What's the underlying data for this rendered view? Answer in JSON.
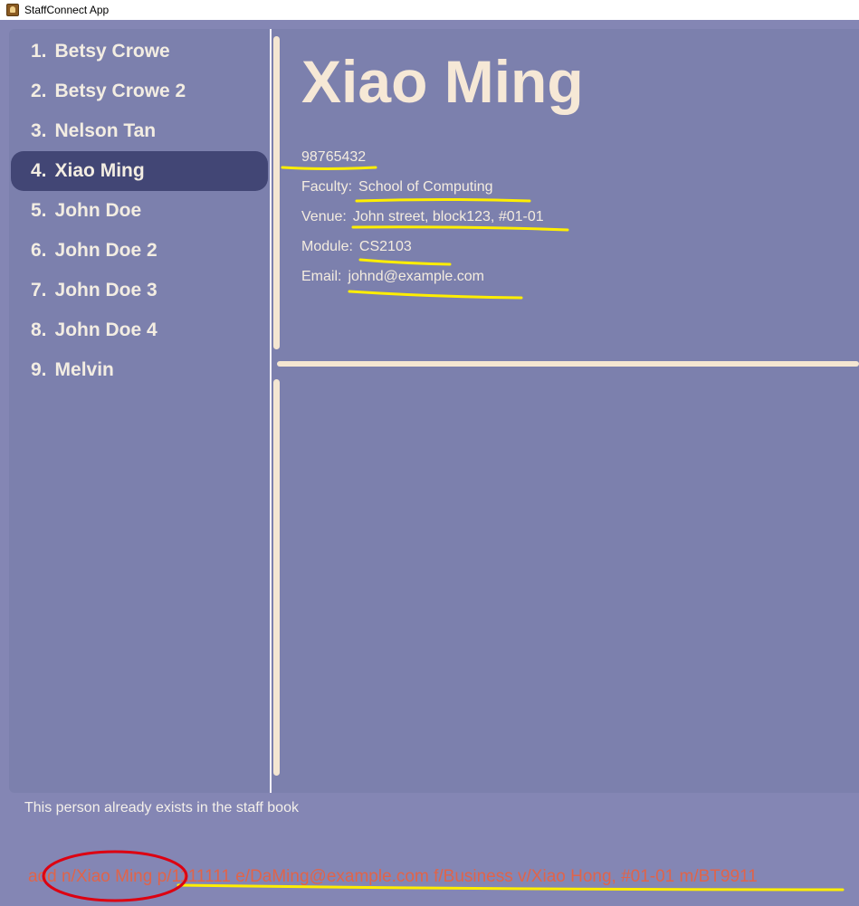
{
  "window": {
    "title": "StaffConnect App"
  },
  "person_list": [
    {
      "index": "1.",
      "name": "Betsy Crowe"
    },
    {
      "index": "2.",
      "name": "Betsy Crowe 2"
    },
    {
      "index": "3.",
      "name": "Nelson Tan"
    },
    {
      "index": "4.",
      "name": "Xiao Ming"
    },
    {
      "index": "5.",
      "name": "John Doe"
    },
    {
      "index": "6.",
      "name": "John Doe 2"
    },
    {
      "index": "7.",
      "name": "John Doe 3"
    },
    {
      "index": "8.",
      "name": "John Doe 4"
    },
    {
      "index": "9.",
      "name": "Melvin"
    }
  ],
  "selected_index": 3,
  "detail": {
    "name": "Xiao Ming",
    "phone": "98765432",
    "faculty_label": "Faculty:",
    "faculty": "School of Computing",
    "venue_label": "Venue:",
    "venue": "John street, block123, #01-01",
    "module_label": "Module:",
    "module": "CS2103",
    "email_label": "Email:",
    "email": "johnd@example.com"
  },
  "result": {
    "message": "This person already exists in the staff book"
  },
  "command": {
    "value": "add n/Xiao Ming p/1111111 e/DaMing@example.com f/Business v/Xiao Hong, #01-01 m/BT9911"
  },
  "colors": {
    "window_bg": "#8486b4",
    "panel_bg": "#7c80ad",
    "selected_bg": "#424675",
    "text": "#f3ede2",
    "command_text": "#e0644a",
    "highlight_yellow": "#ffee00",
    "circle_red": "#dd0011"
  }
}
